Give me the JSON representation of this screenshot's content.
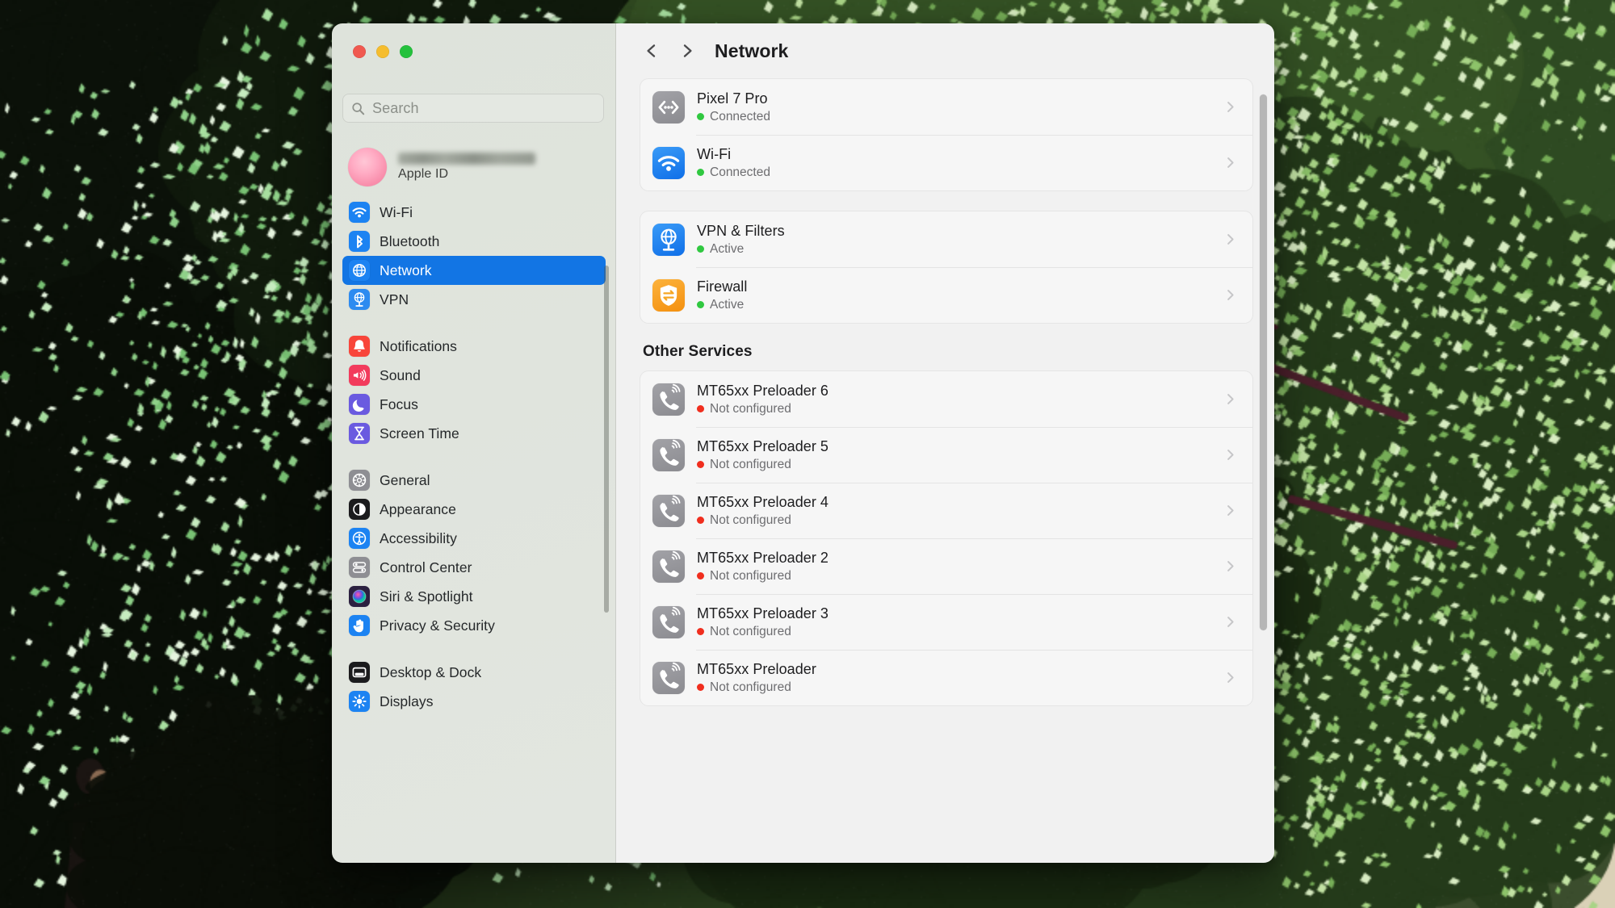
{
  "window": {
    "traffic_lights": [
      {
        "name": "close",
        "color": "#f0594f"
      },
      {
        "name": "minimize",
        "color": "#f5bd2e"
      },
      {
        "name": "zoom",
        "color": "#24c13c"
      }
    ]
  },
  "sidebar": {
    "search": {
      "placeholder": "Search",
      "value": ""
    },
    "account": {
      "name": "",
      "subtitle": "Apple ID"
    },
    "groups": [
      {
        "items": [
          {
            "label": "Wi-Fi",
            "icon": "wifi-icon",
            "color": "#1c83f2",
            "active": false
          },
          {
            "label": "Bluetooth",
            "icon": "bluetooth-icon",
            "color": "#1c83f2",
            "active": false
          },
          {
            "label": "Network",
            "icon": "globe-icon",
            "color": "#1c83f2",
            "active": true
          },
          {
            "label": "VPN",
            "icon": "vpn-globe-icon",
            "color": "#2d8bf0",
            "active": false
          }
        ]
      },
      {
        "items": [
          {
            "label": "Notifications",
            "icon": "bell-icon",
            "color": "#f8453a",
            "active": false
          },
          {
            "label": "Sound",
            "icon": "speaker-icon",
            "color": "#f23b5c",
            "active": false
          },
          {
            "label": "Focus",
            "icon": "moon-icon",
            "color": "#6a5ae0",
            "active": false
          },
          {
            "label": "Screen Time",
            "icon": "hourglass-icon",
            "color": "#6a5ae0",
            "active": false
          }
        ]
      },
      {
        "items": [
          {
            "label": "General",
            "icon": "gear-icon",
            "color": "#8e8e93",
            "active": false
          },
          {
            "label": "Appearance",
            "icon": "appearance-icon",
            "color": "#1b1b1d",
            "active": false
          },
          {
            "label": "Accessibility",
            "icon": "accessibility-icon",
            "color": "#1c83f2",
            "active": false
          },
          {
            "label": "Control Center",
            "icon": "control-center-icon",
            "color": "#8e8e93",
            "active": false
          },
          {
            "label": "Siri & Spotlight",
            "icon": "siri-icon",
            "color": "#2b2040",
            "active": false
          },
          {
            "label": "Privacy & Security",
            "icon": "hand-icon",
            "color": "#1c83f2",
            "active": false
          }
        ]
      },
      {
        "items": [
          {
            "label": "Desktop & Dock",
            "icon": "dock-icon",
            "color": "#1b1b1d",
            "active": false
          },
          {
            "label": "Displays",
            "icon": "brightness-icon",
            "color": "#1c83f2",
            "active": false
          }
        ]
      }
    ]
  },
  "header": {
    "back_icon": "chevron-left-icon",
    "forward_icon": "chevron-right-icon",
    "title": "Network"
  },
  "main": {
    "cards": [
      {
        "rows": [
          {
            "title": "Pixel 7 Pro",
            "status": "Connected",
            "status_color": "#30c840",
            "icon": "usb-ethernet-icon",
            "icon_color": "#8e8e93"
          },
          {
            "title": "Wi-Fi",
            "status": "Connected",
            "status_color": "#30c840",
            "icon": "wifi-icon",
            "icon_color": "#1c83f2"
          }
        ]
      },
      {
        "rows": [
          {
            "title": "VPN & Filters",
            "status": "Active",
            "status_color": "#30c840",
            "icon": "vpn-globe-icon",
            "icon_color": "#2d8bf0"
          },
          {
            "title": "Firewall",
            "status": "Active",
            "status_color": "#30c840",
            "icon": "firewall-icon",
            "icon_color": "#f5a623"
          }
        ]
      }
    ],
    "other_services_header": "Other Services",
    "other_services": [
      {
        "title": "MT65xx Preloader 6",
        "status": "Not configured",
        "status_color": "#f02e1e",
        "icon": "modem-icon",
        "icon_color": "#8e8e93"
      },
      {
        "title": "MT65xx Preloader 5",
        "status": "Not configured",
        "status_color": "#f02e1e",
        "icon": "modem-icon",
        "icon_color": "#8e8e93"
      },
      {
        "title": "MT65xx Preloader 4",
        "status": "Not configured",
        "status_color": "#f02e1e",
        "icon": "modem-icon",
        "icon_color": "#8e8e93"
      },
      {
        "title": "MT65xx Preloader 2",
        "status": "Not configured",
        "status_color": "#f02e1e",
        "icon": "modem-icon",
        "icon_color": "#8e8e93"
      },
      {
        "title": "MT65xx Preloader 3",
        "status": "Not configured",
        "status_color": "#f02e1e",
        "icon": "modem-icon",
        "icon_color": "#8e8e93"
      },
      {
        "title": "MT65xx Preloader",
        "status": "Not configured",
        "status_color": "#f02e1e",
        "icon": "modem-icon",
        "icon_color": "#8e8e93"
      }
    ],
    "row_chevron_icon": "chevron-right-icon"
  }
}
